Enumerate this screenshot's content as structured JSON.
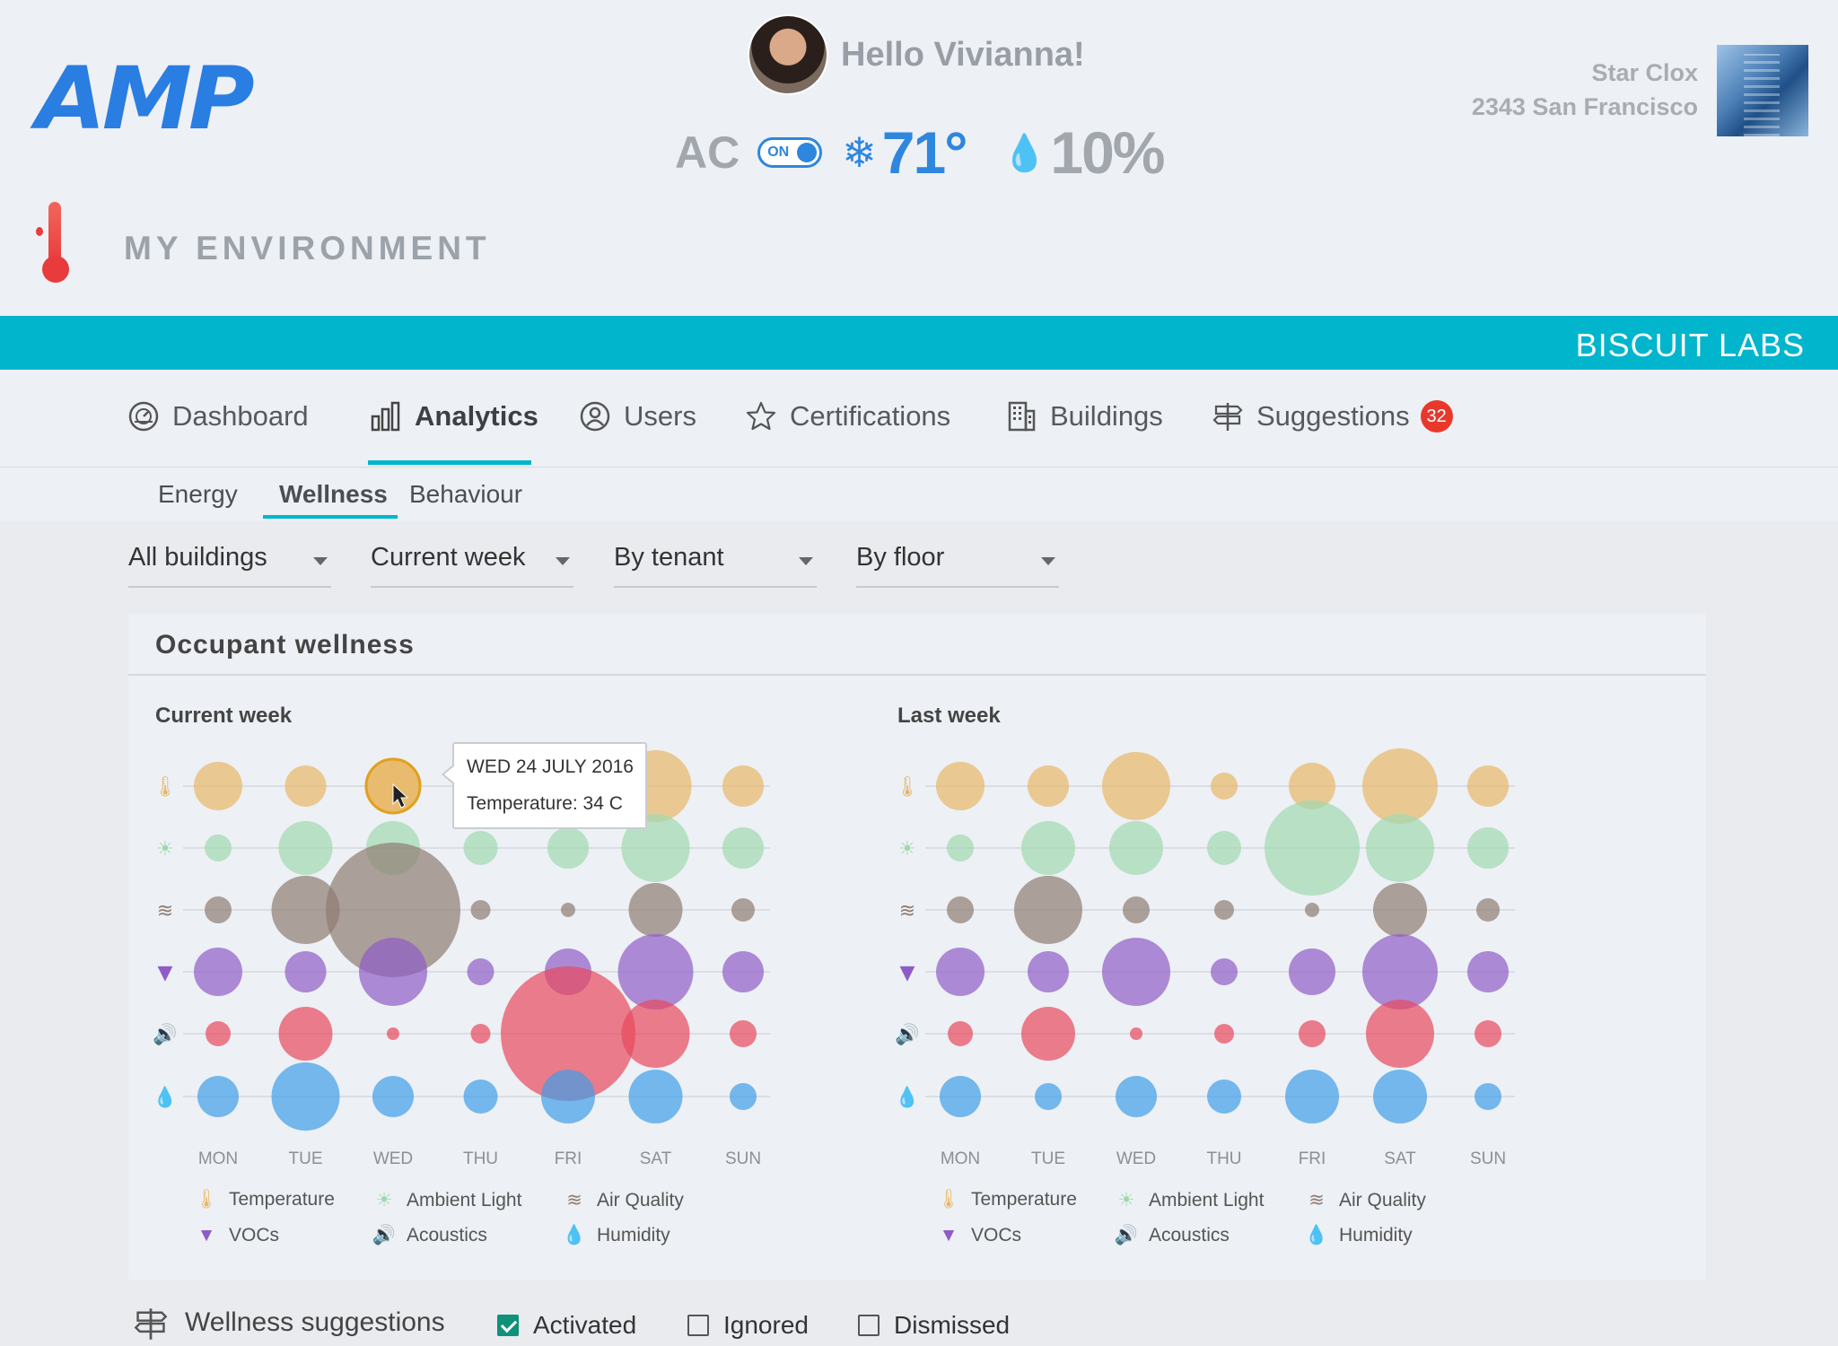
{
  "header": {
    "logo_text": "AMP",
    "greeting": "Hello Vivianna!",
    "ac_label": "AC",
    "ac_toggle_text": "ON",
    "temperature": "71°",
    "humidity": "10%",
    "building_name": "Star Clox",
    "building_address": "2343 San Francisco",
    "section_title": "MY ENVIRONMENT"
  },
  "band": {
    "company": "BISCUIT LABS"
  },
  "nav": {
    "items": [
      {
        "label": "Dashboard",
        "icon": "dashboard-icon"
      },
      {
        "label": "Analytics",
        "icon": "analytics-icon",
        "active": true
      },
      {
        "label": "Users",
        "icon": "user-icon"
      },
      {
        "label": "Certifications",
        "icon": "star-icon"
      },
      {
        "label": "Buildings",
        "icon": "building-icon"
      },
      {
        "label": "Suggestions",
        "icon": "signpost-icon",
        "badge": "32"
      }
    ]
  },
  "subnav": {
    "items": [
      "Energy",
      "Wellness",
      "Behaviour"
    ],
    "active": "Wellness"
  },
  "filters": {
    "buildings": "All buildings",
    "period": "Current week",
    "grouping": "By tenant",
    "floor": "By floor"
  },
  "card": {
    "title": "Occupant wellness"
  },
  "tooltip": {
    "date": "WED 24 JULY 2016",
    "value": "Temperature: 34 C"
  },
  "colors": {
    "Temperature": "#e8b766",
    "Ambient Light": "#9fd8b0",
    "Air Quality": "#8f7c72",
    "VOCs": "#8f5cc7",
    "Acoustics": "#e8495e",
    "Humidity": "#3f9ee8",
    "accent": "#00b5cc"
  },
  "chart_data": [
    {
      "type": "scatter",
      "title": "Current week",
      "categories": [
        "MON",
        "TUE",
        "WED",
        "THU",
        "FRI",
        "SAT",
        "SUN"
      ],
      "series": [
        {
          "name": "Temperature",
          "sizes": [
            27,
            23,
            30,
            20,
            21,
            40,
            23
          ]
        },
        {
          "name": "Ambient Light",
          "sizes": [
            15,
            30,
            30,
            19,
            23,
            38,
            23
          ]
        },
        {
          "name": "Air Quality",
          "sizes": [
            15,
            38,
            75,
            11,
            8,
            30,
            13
          ]
        },
        {
          "name": "VOCs",
          "sizes": [
            27,
            23,
            38,
            15,
            26,
            42,
            23
          ]
        },
        {
          "name": "Acoustics",
          "sizes": [
            14,
            30,
            7,
            11,
            75,
            38,
            15
          ]
        },
        {
          "name": "Humidity",
          "sizes": [
            23,
            38,
            23,
            19,
            30,
            30,
            15
          ]
        }
      ],
      "highlight": {
        "series": "Temperature",
        "category": "WED"
      }
    },
    {
      "type": "scatter",
      "title": "Last week",
      "categories": [
        "MON",
        "TUE",
        "WED",
        "THU",
        "FRI",
        "SAT",
        "SUN"
      ],
      "series": [
        {
          "name": "Temperature",
          "sizes": [
            27,
            23,
            38,
            15,
            26,
            42,
            23
          ]
        },
        {
          "name": "Ambient Light",
          "sizes": [
            15,
            30,
            30,
            19,
            53,
            38,
            23
          ]
        },
        {
          "name": "Air Quality",
          "sizes": [
            15,
            38,
            15,
            11,
            8,
            30,
            13
          ]
        },
        {
          "name": "VOCs",
          "sizes": [
            27,
            23,
            38,
            15,
            26,
            42,
            23
          ]
        },
        {
          "name": "Acoustics",
          "sizes": [
            14,
            30,
            7,
            11,
            15,
            38,
            15
          ]
        },
        {
          "name": "Humidity",
          "sizes": [
            23,
            15,
            23,
            19,
            30,
            30,
            15
          ]
        }
      ]
    }
  ],
  "legend": [
    "Temperature",
    "Ambient Light",
    "Air Quality",
    "VOCs",
    "Acoustics",
    "Humidity"
  ],
  "suggestions": {
    "title": "Wellness suggestions",
    "options": [
      {
        "label": "Activated",
        "checked": true
      },
      {
        "label": "Ignored",
        "checked": false
      },
      {
        "label": "Dismissed",
        "checked": false
      }
    ]
  }
}
